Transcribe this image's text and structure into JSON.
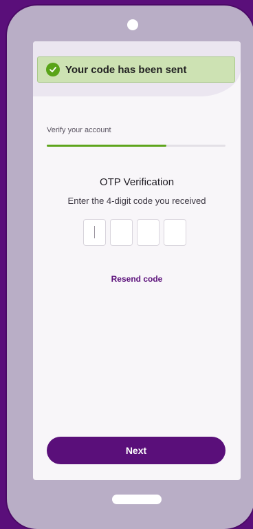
{
  "toast": {
    "icon": "check-circle-icon",
    "message": "Your code has been sent",
    "color": "#cde2b3"
  },
  "progress": {
    "label": "Verify your account",
    "value_percent": 67,
    "fill_color": "#5ea51c"
  },
  "otp": {
    "title": "OTP Verification",
    "instruction": "Enter the 4-digit code you received",
    "digits": [
      "",
      "",
      "",
      ""
    ]
  },
  "resend_label": "Resend code",
  "next_label": "Next",
  "colors": {
    "brand": "#5a0f7a",
    "success": "#59a418"
  }
}
